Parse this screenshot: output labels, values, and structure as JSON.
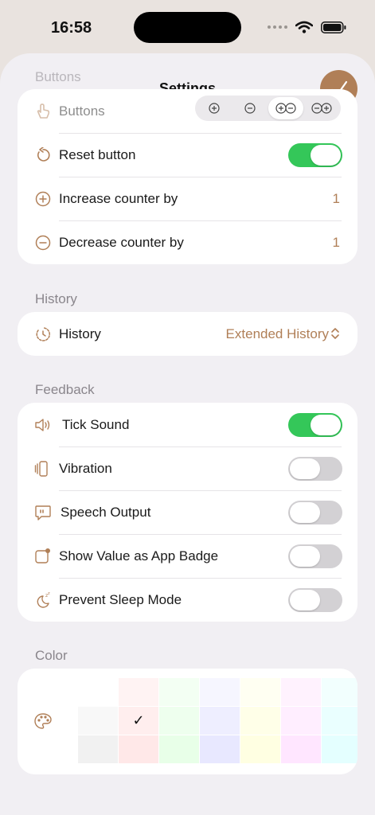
{
  "status": {
    "time": "16:58"
  },
  "sheet": {
    "title": "Settings",
    "ghost_header": "Buttons",
    "done_icon": "checkmark-icon",
    "accent": "#b07f57"
  },
  "buttons_section": {
    "buttons_row": {
      "label": "Buttons",
      "icon": "hand-tap-icon",
      "options": [
        "⊕",
        "⊖",
        "⊕⊖",
        "⊖⊕"
      ],
      "selected_index": 2
    },
    "reset": {
      "label": "Reset button",
      "icon": "reset-icon",
      "on": true
    },
    "increase": {
      "label": "Increase counter by",
      "icon": "plus-circle-icon",
      "value": "1"
    },
    "decrease": {
      "label": "Decrease counter by",
      "icon": "minus-circle-icon",
      "value": "1"
    }
  },
  "history_section": {
    "header": "History",
    "row": {
      "label": "History",
      "icon": "history-clock-icon",
      "value": "Extended History"
    }
  },
  "feedback_section": {
    "header": "Feedback",
    "rows": [
      {
        "label": "Tick Sound",
        "icon": "speaker-icon",
        "on": true
      },
      {
        "label": "Vibration",
        "icon": "vibration-icon",
        "on": false
      },
      {
        "label": "Speech Output",
        "icon": "speech-bubble-icon",
        "on": false
      },
      {
        "label": "Show Value as App Badge",
        "icon": "app-badge-icon",
        "on": false
      },
      {
        "label": "Prevent Sleep Mode",
        "icon": "sleep-moon-icon",
        "on": false
      }
    ]
  },
  "color_section": {
    "header": "Color",
    "icon": "palette-icon",
    "selected_mark": "✓",
    "grid": [
      [
        "#ffffff",
        "#fff3f3",
        "#f3fff3",
        "#f6f6ff",
        "#fffff2",
        "#fff2fe",
        "#f2fffe"
      ],
      [
        "#f8f8f8",
        "#ffeeee",
        "#eeffee",
        "#eeeeff",
        "#ffffe8",
        "#ffeeff",
        "#eaffff"
      ],
      [
        "#f1f1f1",
        "#ffe8e8",
        "#e8ffe8",
        "#e8e8ff",
        "#ffffe2",
        "#ffe6ff",
        "#e4ffff"
      ]
    ],
    "selected": [
      1,
      1
    ]
  },
  "colors": {
    "toggle_on": "#34c759",
    "toggle_off": "#d3d1d4",
    "label_gray": "#8a868c"
  }
}
